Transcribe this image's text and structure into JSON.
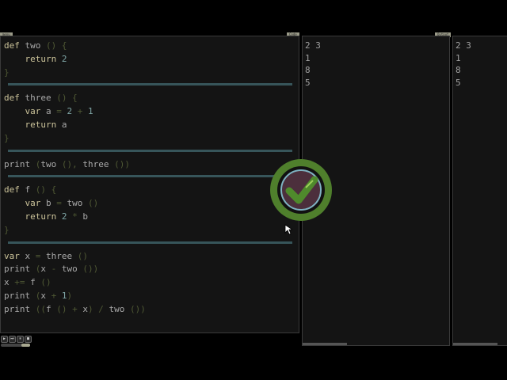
{
  "tabs": {
    "menu": "menu",
    "code": "Code",
    "output": "Output"
  },
  "code_lines": [
    [
      [
        "def",
        "kw"
      ],
      [
        " two ",
        "id"
      ],
      [
        "() {",
        "p"
      ]
    ],
    [
      [
        "    return ",
        "kw"
      ],
      [
        "2",
        "n"
      ]
    ],
    [
      [
        "}",
        "p"
      ]
    ],
    "divider",
    [
      [
        "def",
        "kw"
      ],
      [
        " three ",
        "id"
      ],
      [
        "() {",
        "p"
      ]
    ],
    [
      [
        "    var ",
        "kw"
      ],
      [
        "a ",
        "id"
      ],
      [
        "= ",
        "p"
      ],
      [
        "2 ",
        "n"
      ],
      [
        "+ ",
        "p"
      ],
      [
        "1",
        "n"
      ]
    ],
    [
      [
        "    return ",
        "kw"
      ],
      [
        "a",
        "id"
      ]
    ],
    [
      [
        "}",
        "p"
      ]
    ],
    "divider",
    [
      [
        "print ",
        "id"
      ],
      [
        "(",
        "p"
      ],
      [
        "two ",
        "id"
      ],
      [
        "(), ",
        "p"
      ],
      [
        "three ",
        "id"
      ],
      [
        "())",
        "p"
      ]
    ],
    "divider",
    [
      [
        "def",
        "kw"
      ],
      [
        " f ",
        "id"
      ],
      [
        "() {",
        "p"
      ]
    ],
    [
      [
        "    var ",
        "kw"
      ],
      [
        "b ",
        "id"
      ],
      [
        "= ",
        "p"
      ],
      [
        "two ",
        "id"
      ],
      [
        "()",
        "p"
      ]
    ],
    [
      [
        "    return ",
        "kw"
      ],
      [
        "2 ",
        "n"
      ],
      [
        "* ",
        "p"
      ],
      [
        "b",
        "id"
      ]
    ],
    [
      [
        "}",
        "p"
      ]
    ],
    "divider",
    [
      [
        "var ",
        "kw"
      ],
      [
        "x ",
        "id"
      ],
      [
        "= ",
        "p"
      ],
      [
        "three ",
        "id"
      ],
      [
        "()",
        "p"
      ]
    ],
    [
      [
        "print ",
        "id"
      ],
      [
        "(",
        "p"
      ],
      [
        "x ",
        "id"
      ],
      [
        "- ",
        "p"
      ],
      [
        "two ",
        "id"
      ],
      [
        "())",
        "p"
      ]
    ],
    [
      [
        "x ",
        "id"
      ],
      [
        "+= ",
        "p"
      ],
      [
        "f ",
        "id"
      ],
      [
        "()",
        "p"
      ]
    ],
    [
      [
        "print ",
        "id"
      ],
      [
        "(",
        "p"
      ],
      [
        "x ",
        "id"
      ],
      [
        "+ ",
        "p"
      ],
      [
        "1",
        "n"
      ],
      [
        ")",
        "p"
      ]
    ],
    [
      [
        "print ",
        "id"
      ],
      [
        "((",
        "p"
      ],
      [
        "f ",
        "id"
      ],
      [
        "() + ",
        "p"
      ],
      [
        "x",
        "id"
      ],
      [
        ") / ",
        "p"
      ],
      [
        "two ",
        "id"
      ],
      [
        "())",
        "p"
      ]
    ]
  ],
  "output": [
    "2 3",
    "1",
    "8",
    "5"
  ],
  "output_mirror": [
    "2 3",
    "1",
    "8",
    "5"
  ],
  "controls": [
    "▶",
    "⏭",
    "⏸",
    "■"
  ],
  "badge": {
    "icon": "check-icon",
    "status": "success"
  },
  "colors": {
    "accent": "#4f7f2c",
    "divider": "#37555a",
    "background": "#141414"
  }
}
